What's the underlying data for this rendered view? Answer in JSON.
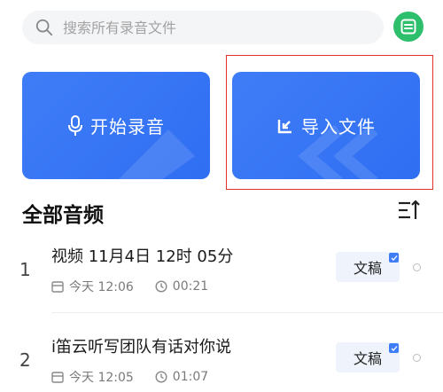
{
  "search": {
    "placeholder": "搜索所有录音文件"
  },
  "actions": {
    "record_label": "开始录音",
    "import_label": "导入文件"
  },
  "section": {
    "title": "全部音频"
  },
  "recordings": [
    {
      "index": "1",
      "title": "视频 11月4日 12时 05分",
      "date": "今天 12:06",
      "duration": "00:21",
      "doc_label": "文稿"
    },
    {
      "index": "2",
      "title": "i笛云听写团队有话对你说",
      "date": "今天 12:05",
      "duration": "01:07",
      "doc_label": "文稿"
    }
  ],
  "colors": {
    "accent": "#3f7df7",
    "menu_green": "#2dbf6c",
    "highlight": "#e0322b"
  }
}
